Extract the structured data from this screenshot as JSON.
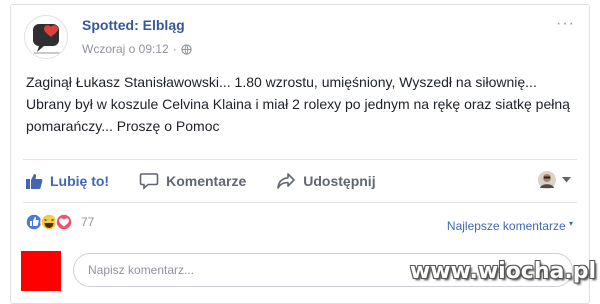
{
  "post": {
    "page_name": "Spotted: Elbląg",
    "timestamp": "Wczoraj o 09:12",
    "more_label": "···",
    "text": "Zaginął Łukasz Stanisławowski... 1.80 wzrostu, umięśniony, Wyszedł na siłownię... Ubrany był w koszule Celvina Klaina i miał 2 rolexy po jednym na rękę oraz siatkę pełną pomarańczy... Proszę o Pomoc"
  },
  "actions": {
    "like": "Lubię to!",
    "comment": "Komentarze",
    "share": "Udostępnij"
  },
  "reactions": {
    "count": "77",
    "icons": [
      "like-icon",
      "haha-icon",
      "love-icon"
    ]
  },
  "comments": {
    "sort_label": "Najlepsze komentarze",
    "input_placeholder": "Napisz komentarz..."
  },
  "colors": {
    "link": "#365899",
    "accent": "#4267b2",
    "muted": "#90949c",
    "censor": "#ff0000"
  },
  "watermark": "www.wiocha.pl"
}
